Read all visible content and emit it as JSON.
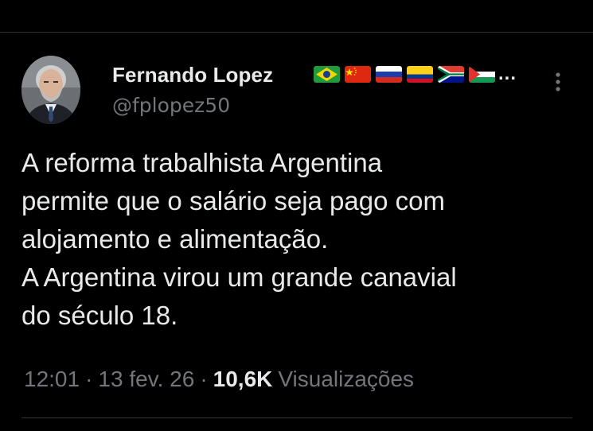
{
  "tweet": {
    "author": {
      "name": "Fernando Lopez",
      "handle": "@fplopez50",
      "flags": [
        "brazil-flag",
        "china-flag",
        "russia-flag",
        "colombia-flag",
        "south-africa-flag",
        "palestine-flag"
      ],
      "flags_truncation": "...",
      "avatar": "avatar-photo"
    },
    "text_lines": [
      "A reforma trabalhista Argentina",
      "permite que o salário seja pago com",
      "alojamento e alimentação.",
      "A Argentina virou um grande canavial",
      "do século 18."
    ],
    "time": "12:01",
    "separator": "·",
    "date": "13 fev. 26",
    "views_count": "10,6K",
    "views_label": "Visualizações"
  },
  "colors": {
    "background": "#000000",
    "text_primary": "#e7e9ea",
    "text_secondary": "#71767b",
    "divider": "#2f3336"
  },
  "icons": {
    "more": "more-vertical-icon"
  }
}
